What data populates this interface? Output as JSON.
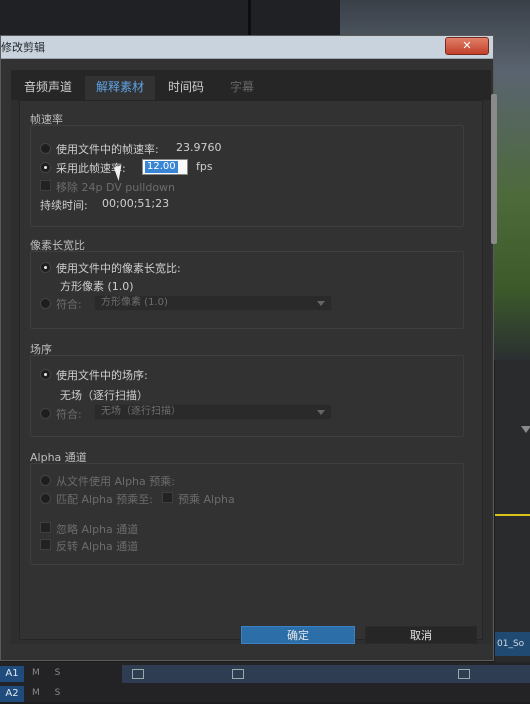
{
  "dialog": {
    "title": "修改剪辑",
    "close_label": "✕"
  },
  "tabs": [
    {
      "label": "音频声道"
    },
    {
      "label": "解释素材"
    },
    {
      "label": "时间码"
    },
    {
      "label": "字幕"
    }
  ],
  "frame_rate": {
    "title": "帧速率",
    "use_file_label": "使用文件中的帧速率:",
    "use_file_value": "23.9760",
    "assume_label": "采用此帧速率:",
    "assume_value": "12.00",
    "unit": "fps",
    "pulldown_label": "移除 24p DV pulldown",
    "duration_label": "持续时间:",
    "duration_value": "00;00;51;23"
  },
  "pixel_aspect": {
    "title": "像素长宽比",
    "use_file_label": "使用文件中的像素长宽比:",
    "use_file_value": "方形像素 (1.0)",
    "conform_label": "符合:",
    "conform_value": "方形像素 (1.0)"
  },
  "field_order": {
    "title": "场序",
    "use_file_label": "使用文件中的场序:",
    "use_file_value": "无场（逐行扫描）",
    "conform_label": "符合:",
    "conform_value": "无场（逐行扫描）"
  },
  "alpha": {
    "title": "Alpha 通道",
    "use_file_label": "从文件使用 Alpha 预乘:",
    "conform_label": "匹配 Alpha 预乘至:",
    "premultiplied_label": "预乘 Alpha",
    "ignore_label": "忽略 Alpha 通道",
    "invert_label": "反转 Alpha 通道"
  },
  "buttons": {
    "ok": "确定",
    "cancel": "取消"
  },
  "background": {
    "clip_label": "01_So",
    "tracks": [
      {
        "label": "A1",
        "controls": "M S"
      },
      {
        "label": "A2",
        "controls": "M S"
      }
    ]
  },
  "colors": {
    "accent": "#2c6ea8",
    "active_tab": "#5ea3e6",
    "track_label": "#1f4c7c",
    "playhead_line": "#d9c21a"
  }
}
